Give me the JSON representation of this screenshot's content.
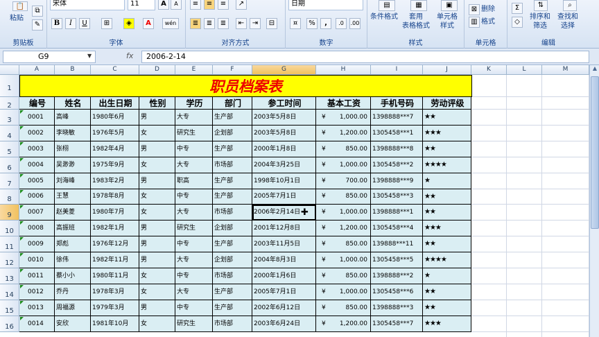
{
  "ribbon": {
    "clipboard": {
      "paste": "粘贴",
      "group": "剪贴板"
    },
    "font": {
      "name": "宋体",
      "size": "11",
      "group": "字体",
      "bold": "B",
      "italic": "I",
      "underline": "U",
      "grow": "A",
      "shrink": "A",
      "color_letter": "A",
      "wen": "wén"
    },
    "alignment": {
      "group": "对齐方式"
    },
    "number": {
      "format": "日期",
      "group": "数字",
      "percent": "%",
      "comma": ","
    },
    "styles": {
      "conditional": "条件格式",
      "table_fmt": "套用\n表格格式",
      "cell_style": "单元格\n样式",
      "group": "样式"
    },
    "cells": {
      "delete": "删除",
      "format": "格式",
      "group": "单元格"
    },
    "editing": {
      "sort": "排序和\n筛选",
      "find": "查找和\n选择",
      "group": "编辑"
    }
  },
  "formula_bar": {
    "cell_ref": "G9",
    "fx": "fx",
    "value": "2006-2-14"
  },
  "columns": [
    "A",
    "B",
    "C",
    "D",
    "E",
    "F",
    "G",
    "H",
    "I",
    "J",
    "K",
    "L",
    "M"
  ],
  "selected_column": "G",
  "selected_row": "9",
  "title": "职员档案表",
  "headers": [
    "编号",
    "姓名",
    "出生日期",
    "性别",
    "学历",
    "部门",
    "参工时间",
    "基本工资",
    "手机号码",
    "劳动评级"
  ],
  "currency": "¥",
  "rows": [
    {
      "n": "3",
      "id": "0001",
      "name": "高峰",
      "birth": "1980年6月",
      "sex": "男",
      "edu": "大专",
      "dept": "生产部",
      "join": "2003年5月8日",
      "salary": "1,000.00",
      "phone": "1398888***7",
      "rating": "★★"
    },
    {
      "n": "4",
      "id": "0002",
      "name": "李晓敏",
      "birth": "1976年5月",
      "sex": "女",
      "edu": "研究生",
      "dept": "企划部",
      "join": "2003年5月8日",
      "salary": "1,200.00",
      "phone": "1305458***1",
      "rating": "★★★"
    },
    {
      "n": "5",
      "id": "0003",
      "name": "张栩",
      "birth": "1982年4月",
      "sex": "男",
      "edu": "中专",
      "dept": "生产部",
      "join": "2000年1月8日",
      "salary": "850.00",
      "phone": "1398888***8",
      "rating": "★★"
    },
    {
      "n": "6",
      "id": "0004",
      "name": "吴渺渺",
      "birth": "1975年9月",
      "sex": "女",
      "edu": "大专",
      "dept": "市场部",
      "join": "2004年3月25日",
      "salary": "1,000.00",
      "phone": "1305458***2",
      "rating": "★★★★"
    },
    {
      "n": "7",
      "id": "0005",
      "name": "刘海峰",
      "birth": "1983年2月",
      "sex": "男",
      "edu": "职高",
      "dept": "生产部",
      "join": "1998年10月1日",
      "salary": "700.00",
      "phone": "1398888***9",
      "rating": "★"
    },
    {
      "n": "8",
      "id": "0006",
      "name": "王慧",
      "birth": "1978年8月",
      "sex": "女",
      "edu": "中专",
      "dept": "生产部",
      "join": "2005年7月1日",
      "salary": "850.00",
      "phone": "1305458***3",
      "rating": "★★"
    },
    {
      "n": "9",
      "id": "0007",
      "name": "赵美菱",
      "birth": "1980年7月",
      "sex": "女",
      "edu": "大专",
      "dept": "市场部",
      "join": "2006年2月14日",
      "salary": "1,000.00",
      "phone": "1398888***1",
      "rating": "★★"
    },
    {
      "n": "10",
      "id": "0008",
      "name": "高振班",
      "birth": "1982年1月",
      "sex": "男",
      "edu": "研究生",
      "dept": "企划部",
      "join": "2001年12月8日",
      "salary": "1,200.00",
      "phone": "1305458***4",
      "rating": "★★★"
    },
    {
      "n": "11",
      "id": "0009",
      "name": "郑彪",
      "birth": "1976年12月",
      "sex": "男",
      "edu": "中专",
      "dept": "生产部",
      "join": "2003年11月5日",
      "salary": "850.00",
      "phone": "139888***11",
      "rating": "★★"
    },
    {
      "n": "12",
      "id": "0010",
      "name": "徐伟",
      "birth": "1982年11月",
      "sex": "男",
      "edu": "大专",
      "dept": "企划部",
      "join": "2004年8月3日",
      "salary": "1,000.00",
      "phone": "1305458***5",
      "rating": "★★★★"
    },
    {
      "n": "13",
      "id": "0011",
      "name": "蔡小小",
      "birth": "1980年11月",
      "sex": "女",
      "edu": "中专",
      "dept": "市场部",
      "join": "2000年1月6日",
      "salary": "850.00",
      "phone": "1398888***2",
      "rating": "★"
    },
    {
      "n": "14",
      "id": "0012",
      "name": "乔丹",
      "birth": "1978年3月",
      "sex": "女",
      "edu": "大专",
      "dept": "生产部",
      "join": "2005年7月1日",
      "salary": "1,000.00",
      "phone": "1305458***6",
      "rating": "★★"
    },
    {
      "n": "15",
      "id": "0013",
      "name": "周福源",
      "birth": "1979年3月",
      "sex": "男",
      "edu": "中专",
      "dept": "生产部",
      "join": "2002年6月12日",
      "salary": "850.00",
      "phone": "1398888***3",
      "rating": "★★"
    },
    {
      "n": "16",
      "id": "0014",
      "name": "安欣",
      "birth": "1981年10月",
      "sex": "女",
      "edu": "研究生",
      "dept": "市场部",
      "join": "2003年6月24日",
      "salary": "1,200.00",
      "phone": "1305458***7",
      "rating": "★★★"
    }
  ]
}
